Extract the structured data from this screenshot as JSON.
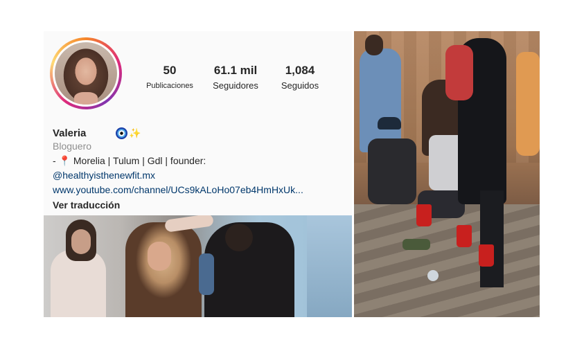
{
  "profile": {
    "stats": [
      {
        "value": "50",
        "label": "Publicaciones"
      },
      {
        "value": "61.1 mil",
        "label": "Seguidores"
      },
      {
        "value": "1,084",
        "label": "Seguidos"
      }
    ],
    "name": "Valeria",
    "emoji": "✨",
    "category": "Bloguero",
    "bio_line": "- 📍 Morelia | Tulum | Gdl | founder:",
    "mention": "@healthyisthenewfit.mx",
    "link": "www.youtube.com/channel/UCs9kALoHo07eb4HmHxUk...",
    "translate_label": "Ver traducción"
  },
  "icons": {
    "nazar": "nazar-amulet-icon",
    "pin": "location-pin-icon",
    "sparkles": "sparkles-icon"
  },
  "colors": {
    "story_ring": [
      "#f58529",
      "#dd2a7b",
      "#8134af",
      "#feda75"
    ],
    "link": "#00376b",
    "secondary_text": "#8e8e8e"
  }
}
